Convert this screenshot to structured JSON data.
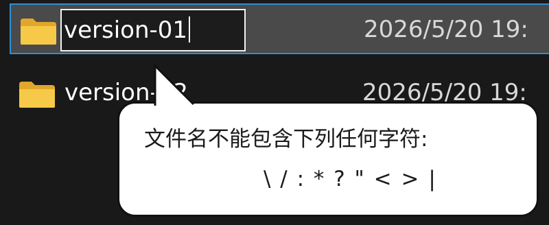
{
  "files": [
    {
      "name": "version-01",
      "date": "2026/5/20 19:",
      "icon": "folder-icon",
      "selected": true,
      "editing": true
    },
    {
      "name": "version-02",
      "date": "2026/5/20 19:",
      "icon": "folder-icon",
      "selected": false,
      "editing": false
    }
  ],
  "tooltip": {
    "message": "文件名不能包含下列任何字符:",
    "chars": "\\ / : * ? \" < > |"
  },
  "colors": {
    "background": "#191919",
    "selection_fill": "#4a4a4a",
    "selection_border": "#2f8fd6",
    "folder": "#f5c64a",
    "tooltip_bg": "#ffffff"
  }
}
